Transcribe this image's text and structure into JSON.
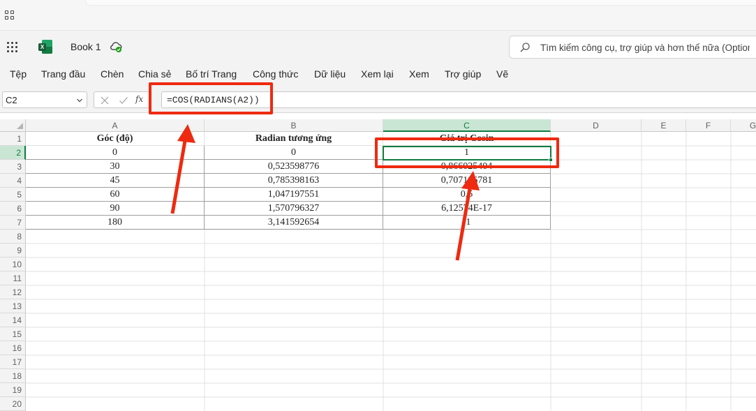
{
  "browser": {
    "apps_icon": "grid-icon"
  },
  "header": {
    "book_name": "Book 1",
    "search_placeholder": "Tìm kiếm công cụ, trợ giúp và hơn thế nữa (Option + Q)"
  },
  "ribbon": {
    "tabs": [
      "Tệp",
      "Trang đầu",
      "Chèn",
      "Chia sẻ",
      "Bố trí Trang",
      "Công thức",
      "Dữ liệu",
      "Xem lại",
      "Xem",
      "Trợ giúp",
      "Vẽ"
    ]
  },
  "formula_bar": {
    "name_box": "C2",
    "fx_label": "fx",
    "formula": "=COS(RADIANS(A2))"
  },
  "sheet": {
    "columns": [
      "A",
      "B",
      "C",
      "D",
      "E",
      "F",
      "G"
    ],
    "selected_column": "C",
    "selected_row": "2",
    "rows": [
      "1",
      "2",
      "3",
      "4",
      "5",
      "6",
      "7",
      "8",
      "9",
      "10",
      "11",
      "12",
      "13",
      "14",
      "15",
      "16",
      "17",
      "18",
      "19",
      "20"
    ],
    "table": {
      "headers": [
        "Góc (độ)",
        "Radian tương ứng",
        "Giá trị Cosin"
      ],
      "data": [
        [
          "0",
          "0",
          "1"
        ],
        [
          "30",
          "0,523598776",
          "0,866025404"
        ],
        [
          "45",
          "0,785398163",
          "0,707106781"
        ],
        [
          "60",
          "1,047197551",
          "0,5"
        ],
        [
          "90",
          "1,570796327",
          "6,12574E-17"
        ],
        [
          "180",
          "3,141592654",
          "-1"
        ]
      ]
    }
  },
  "annotation": {
    "color": "#ee2a10"
  },
  "colors": {
    "accent": "#107c41",
    "selected_header": "#c9e6d4"
  }
}
